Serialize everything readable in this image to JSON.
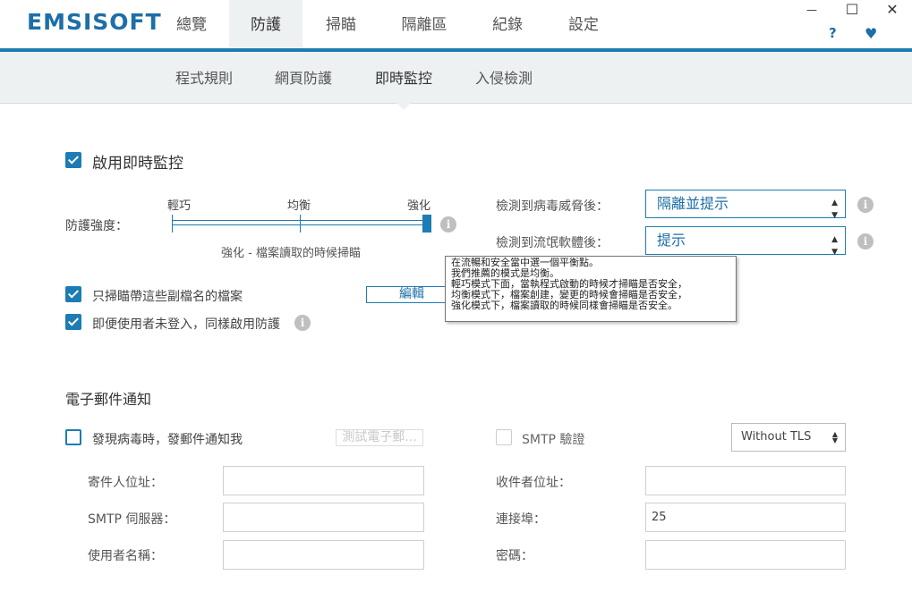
{
  "app": {
    "logo": "EMSISOFT"
  },
  "main_tabs": [
    {
      "label": "總覽"
    },
    {
      "label": "防護",
      "active": true
    },
    {
      "label": "掃瞄"
    },
    {
      "label": "隔離區"
    },
    {
      "label": "紀錄"
    },
    {
      "label": "設定"
    }
  ],
  "window_controls": {
    "minimize": "—",
    "maximize": "☐",
    "close": "✕",
    "help": "?",
    "favorite": "♥"
  },
  "sub_tabs": [
    {
      "label": "程式規則"
    },
    {
      "label": "網頁防護"
    },
    {
      "label": "即時監控",
      "active": true
    },
    {
      "label": "入侵檢測"
    }
  ],
  "realtime": {
    "enable_label": "啟用即時監控",
    "enable_checked": true,
    "strength_label": "防護強度：",
    "slider_labels": [
      "輕巧",
      "均衡",
      "強化"
    ],
    "slider_value": "強化",
    "slider_description": "強化 - 檔案讀取的時候掃瞄",
    "only_ext_label": "只掃瞄帶這些副檔名的檔案",
    "only_ext_checked": true,
    "edit_button": "編輯",
    "not_logged_label": "即便使用者未登入，同樣啟用防護",
    "not_logged_checked": true,
    "virus_label": "檢測到病毒威脅後：",
    "virus_value": "隔離並提示",
    "pup_label": "檢測到流氓軟體後：",
    "pup_value": "提示"
  },
  "tooltip": {
    "lines": [
      "在流暢和安全當中選一個平衡點。",
      "我們推薦的模式是均衡。",
      "輕巧模式下面，當執程式啟動的時候才掃瞄是否安全，",
      "均衡模式下，檔案創建，變更的時候會掃瞄是否安全，",
      "強化模式下，檔案讀取的時候同樣會掃瞄是否安全。"
    ]
  },
  "email": {
    "title": "電子郵件通知",
    "notify_label": "發現病毒時，發郵件通知我",
    "notify_checked": false,
    "test_button": "測試電子郵...",
    "smtp_auth_label": "SMTP 驗證",
    "smtp_auth_checked": false,
    "tls_value": "Without TLS",
    "sender_label": "寄件人位址：",
    "sender_value": "",
    "recipient_label": "收件者位址：",
    "recipient_value": "",
    "server_label": "SMTP 伺服器：",
    "server_value": "",
    "port_label": "連接埠：",
    "port_value": "25",
    "username_label": "使用者名稱：",
    "username_value": "",
    "password_label": "密碼：",
    "password_value": ""
  },
  "icons": {
    "info": "i",
    "select_arrow": "▲▼"
  },
  "colors": {
    "accent": "#1d7cb3",
    "subnav_bg": "#eef1f2"
  }
}
